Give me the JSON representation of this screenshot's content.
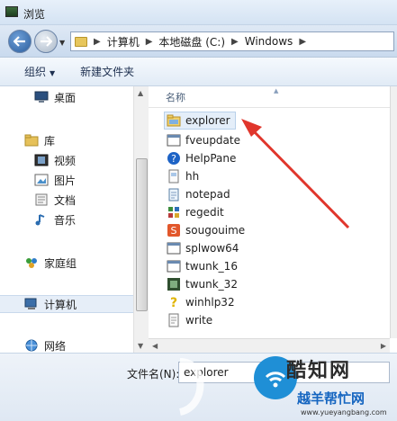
{
  "window": {
    "title": "浏览"
  },
  "address": {
    "crumbs": [
      "计算机",
      "本地磁盘 (C:)",
      "Windows"
    ]
  },
  "toolbar": {
    "organize_label": "组织",
    "new_folder_label": "新建文件夹"
  },
  "sidebar": {
    "items": [
      {
        "label": "桌面",
        "icon": "desktop-icon"
      },
      {
        "label": "库",
        "icon": "library-icon"
      },
      {
        "label": "视频",
        "icon": "video-icon"
      },
      {
        "label": "图片",
        "icon": "picture-icon"
      },
      {
        "label": "文档",
        "icon": "document-icon"
      },
      {
        "label": "音乐",
        "icon": "music-icon"
      },
      {
        "label": "家庭组",
        "icon": "homegroup-icon"
      },
      {
        "label": "计算机",
        "icon": "computer-icon"
      },
      {
        "label": "网络",
        "icon": "network-icon"
      }
    ]
  },
  "filelist": {
    "column_name": "名称",
    "files": [
      {
        "name": "explorer",
        "icon": "explorer-folder-icon"
      },
      {
        "name": "fveupdate",
        "icon": "app-window-icon"
      },
      {
        "name": "HelpPane",
        "icon": "help-icon"
      },
      {
        "name": "hh",
        "icon": "hh-doc-icon"
      },
      {
        "name": "notepad",
        "icon": "notepad-icon"
      },
      {
        "name": "regedit",
        "icon": "regedit-icon"
      },
      {
        "name": "sougouime",
        "icon": "sougou-icon"
      },
      {
        "name": "splwow64",
        "icon": "app-window-icon"
      },
      {
        "name": "twunk_16",
        "icon": "app-window-icon"
      },
      {
        "name": "twunk_32",
        "icon": "twunk-icon"
      },
      {
        "name": "winhlp32",
        "icon": "winhelp-icon"
      },
      {
        "name": "write",
        "icon": "write-icon"
      }
    ]
  },
  "bottom": {
    "filename_label": "文件名(N):",
    "filename_value": "explorer"
  },
  "watermark": {
    "main": "酷知网",
    "sub": "越羊帮忙网",
    "url": "www.yueyangbang.com"
  },
  "colors": {
    "arrow": "#e0362c",
    "watermark_blue": "#1f8fd6",
    "selection": "#e4eef9"
  }
}
